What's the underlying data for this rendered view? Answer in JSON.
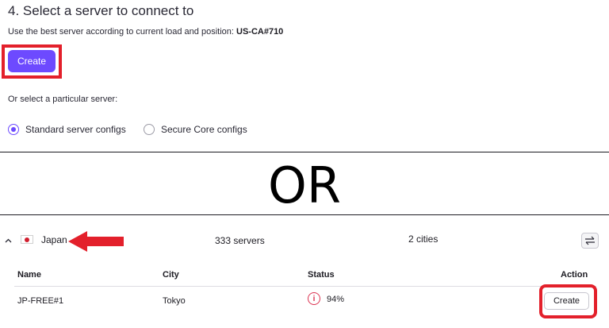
{
  "step": {
    "title": "4. Select a server to connect to",
    "best_text": "Use the best server according to current load and position:",
    "best_server": "US-CA#710",
    "create_label": "Create",
    "or_select_text": "Or select a particular server:"
  },
  "config_options": [
    {
      "label": "Standard server configs",
      "selected": true
    },
    {
      "label": "Secure Core configs",
      "selected": false
    }
  ],
  "divider_text": "OR",
  "country": {
    "name": "Japan",
    "flag_icon": "japan-flag-icon",
    "servers": "333 servers",
    "cities": "2 cities"
  },
  "table": {
    "columns": [
      "Name",
      "City",
      "Status",
      "Action"
    ],
    "rows": [
      {
        "name": "JP-FREE#1",
        "city": "Tokyo",
        "status": "94%",
        "action": "Create"
      }
    ]
  },
  "colors": {
    "accent": "#6d4aff",
    "highlight": "#e3202b",
    "status_load": "#dc3251"
  }
}
